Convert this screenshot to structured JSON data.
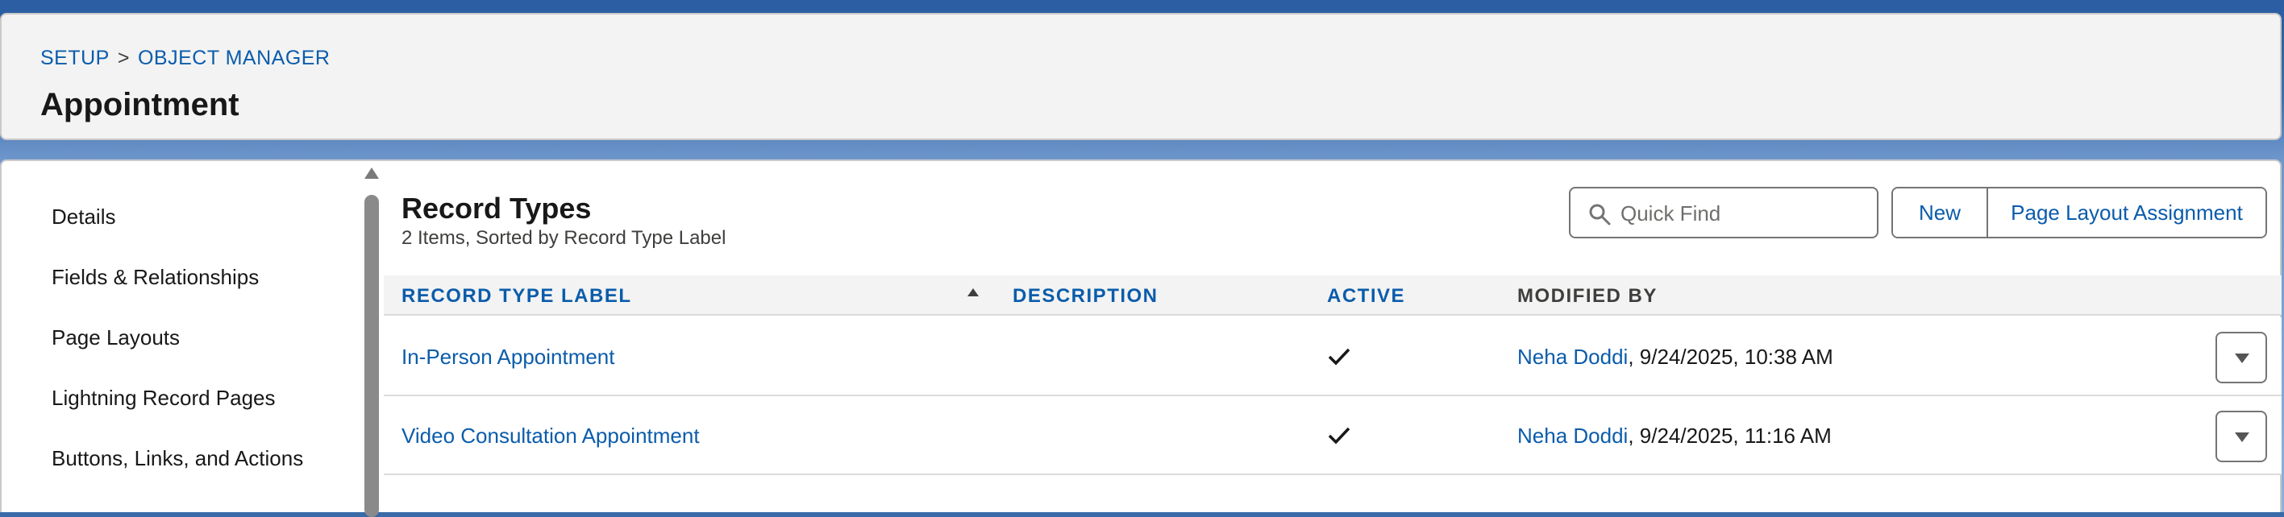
{
  "breadcrumb": {
    "setup": "SETUP",
    "separator": ">",
    "object_manager": "OBJECT MANAGER"
  },
  "header": {
    "title": "Appointment"
  },
  "sidebar": {
    "items": [
      {
        "label": "Details"
      },
      {
        "label": "Fields & Relationships"
      },
      {
        "label": "Page Layouts"
      },
      {
        "label": "Lightning Record Pages"
      },
      {
        "label": "Buttons, Links, and Actions"
      }
    ]
  },
  "record_types": {
    "title": "Record Types",
    "subtitle": "2 Items, Sorted by Record Type Label",
    "search": {
      "placeholder": "Quick Find",
      "icon": "search-icon"
    },
    "buttons": {
      "new": "New",
      "page_layout_assignment": "Page Layout Assignment"
    },
    "columns": {
      "label": "RECORD TYPE LABEL",
      "description": "DESCRIPTION",
      "active": "ACTIVE",
      "modified_by": "MODIFIED BY"
    },
    "sort": {
      "column": "RECORD TYPE LABEL",
      "direction": "ascending"
    },
    "rows": [
      {
        "label": "In-Person Appointment",
        "description": "",
        "active": true,
        "modified_by": "Neha Doddi",
        "modified_at": ", 9/24/2025, 10:38 AM"
      },
      {
        "label": "Video Consultation Appointment",
        "description": "",
        "active": true,
        "modified_by": "Neha Doddi",
        "modified_at": ", 9/24/2025, 11:16 AM"
      }
    ]
  },
  "colors": {
    "link": "#0b5cab",
    "text": "#181818",
    "border": "#747474",
    "header_bg": "#f3f3f3",
    "brand_blue": "#2b5ea3"
  }
}
